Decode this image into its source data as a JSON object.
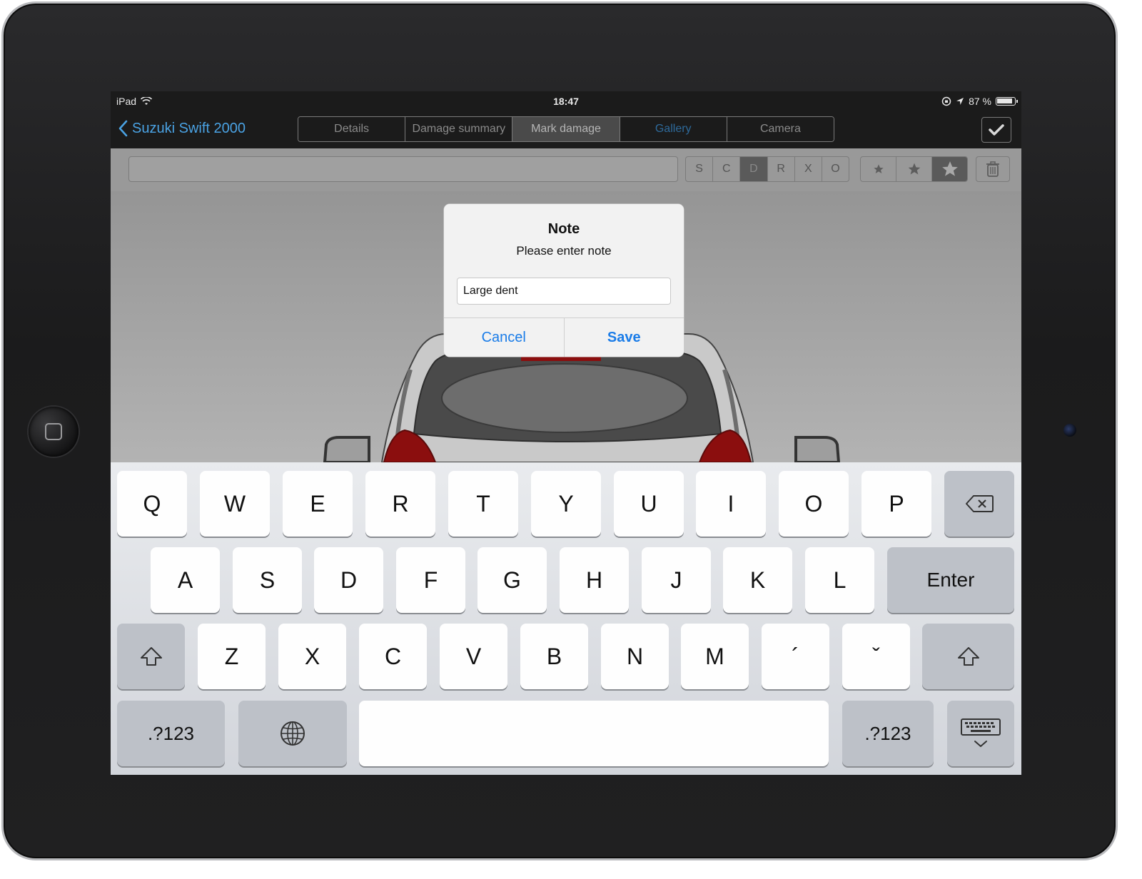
{
  "statusbar": {
    "device": "iPad",
    "time": "18:47",
    "battery": "87 %"
  },
  "navbar": {
    "back_label": "Suzuki Swift 2000",
    "tabs": [
      {
        "label": "Details"
      },
      {
        "label": "Damage summary"
      },
      {
        "label": "Mark damage"
      },
      {
        "label": "Gallery"
      },
      {
        "label": "Camera"
      }
    ],
    "active_tab": "Mark damage"
  },
  "toolbar": {
    "letters": [
      "S",
      "C",
      "D",
      "R",
      "X",
      "O"
    ],
    "active_letter": "D"
  },
  "dialog": {
    "title": "Note",
    "message": "Please enter note",
    "input_value": "Large dent",
    "cancel_label": "Cancel",
    "save_label": "Save"
  },
  "keyboard": {
    "row1": [
      "Q",
      "W",
      "E",
      "R",
      "T",
      "Y",
      "U",
      "I",
      "O",
      "P"
    ],
    "row2": [
      "A",
      "S",
      "D",
      "F",
      "G",
      "H",
      "J",
      "K",
      "L"
    ],
    "enter_label": "Enter",
    "row3": [
      "Z",
      "X",
      "C",
      "V",
      "B",
      "N",
      "M",
      "´",
      "ˇ"
    ],
    "numbers_label": ".?123"
  },
  "colors": {
    "accent": "#1a7ce8",
    "nav_link": "#4aa2e3",
    "car_red": "#8b0e0e",
    "car_body": "#c9c9c9"
  }
}
